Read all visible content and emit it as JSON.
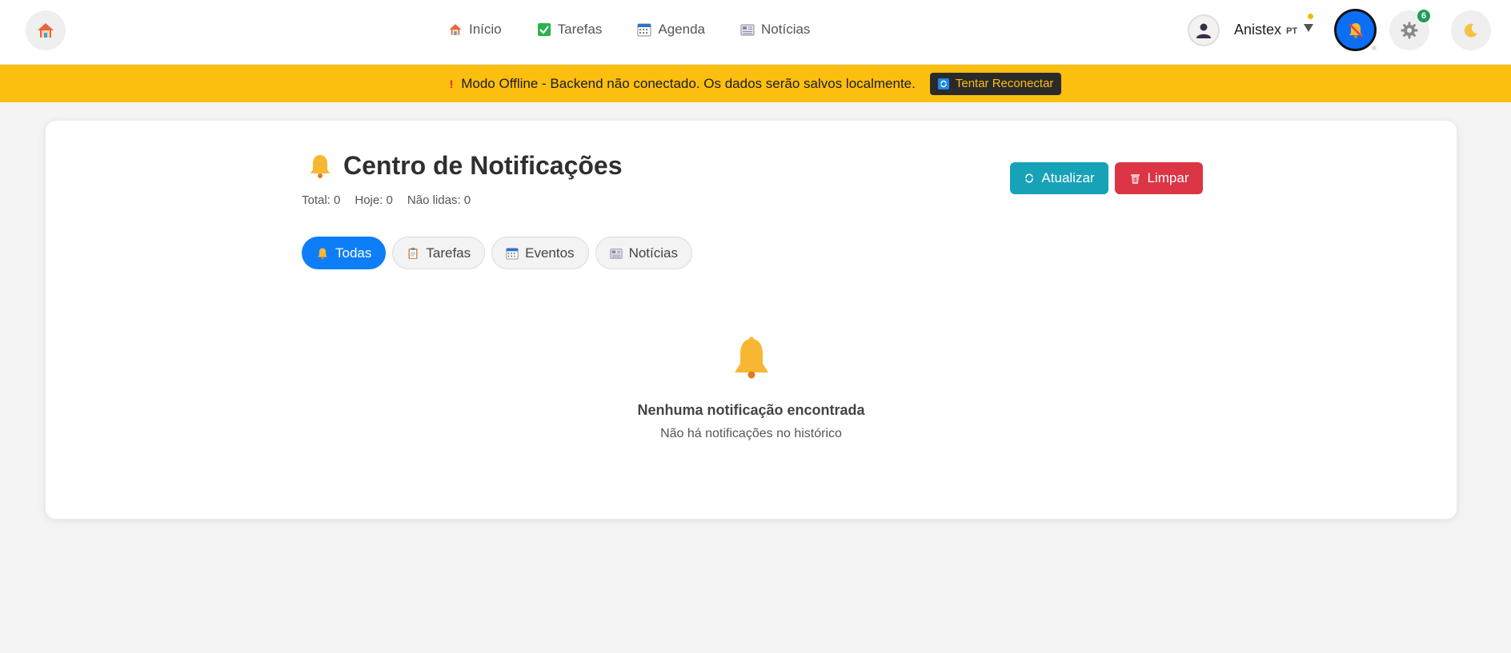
{
  "nav": {
    "items": [
      {
        "label": "Início",
        "icon": "house-icon"
      },
      {
        "label": "Tarefas",
        "icon": "checkbox-icon"
      },
      {
        "label": "Agenda",
        "icon": "calendar-icon"
      },
      {
        "label": "Notícias",
        "icon": "newspaper-icon"
      }
    ]
  },
  "user": {
    "name": "Anistex",
    "lang": "PT"
  },
  "settings": {
    "badge_count": "6"
  },
  "banner": {
    "icon": "!",
    "message": "Modo Offline - Backend não conectado. Os dados serão salvos localmente.",
    "button_label": "Tentar Reconectar"
  },
  "page": {
    "title": "Centro de Notificações",
    "stats": {
      "total": "Total: 0",
      "today": "Hoje: 0",
      "unread": "Não lidas: 0"
    },
    "refresh_label": "Atualizar",
    "clear_label": "Limpar"
  },
  "tabs": [
    {
      "label": "Todas",
      "active": true
    },
    {
      "label": "Tarefas",
      "active": false
    },
    {
      "label": "Eventos",
      "active": false
    },
    {
      "label": "Notícias",
      "active": false
    }
  ],
  "empty": {
    "title": "Nenhuma notificação encontrada",
    "subtitle": "Não há notificações no histórico"
  },
  "colors": {
    "banner": "#fcbf0f",
    "primary": "#0d7ef7",
    "refresh": "#17a2b8",
    "danger": "#dc3545"
  }
}
